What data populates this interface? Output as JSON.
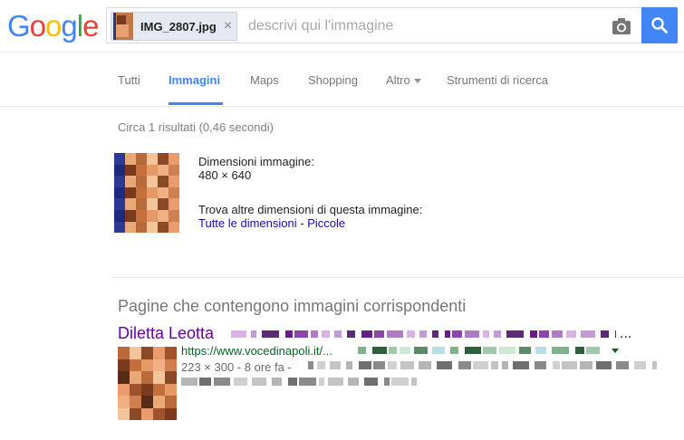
{
  "logo": {
    "text": "Google",
    "letters": [
      "G",
      "o",
      "o",
      "g",
      "l",
      "e"
    ],
    "colors": [
      "#4285f4",
      "#ea4335",
      "#fbbc05",
      "#4285f4",
      "#34a853",
      "#ea4335"
    ]
  },
  "search": {
    "chip_label": "IMG_2807.jpg",
    "chip_close": "×",
    "placeholder": "descrivi qui l'immagine",
    "camera_icon": "camera-icon",
    "search_icon": "search-icon"
  },
  "tabs": {
    "all": "Tutti",
    "images": "Immagini",
    "maps": "Maps",
    "shopping": "Shopping",
    "more": "Altro",
    "tools": "Strumenti di ricerca"
  },
  "results": {
    "stats": "Circa 1 risultati (0,46 secondi)",
    "dimensions_label": "Dimensioni immagine:",
    "dimensions_value": "480 × 640",
    "other_sizes_label": "Trova altre dimensioni di questa immagine:",
    "all_sizes_link": "Tutte le dimensioni",
    "separator": " - ",
    "small_link": "Piccole"
  },
  "matching": {
    "section_title": "Pagine che contengono immagini corrispondenti",
    "title_prefix": "Diletta Leotta",
    "title_ellipsis": "...",
    "url": "https://www.vocedinapoli.it/...",
    "meta": "223 × 300 - 8 ore fa -"
  },
  "colors": {
    "accent": "#4285f4",
    "link": "#1a0dab",
    "visited": "#660099",
    "url_green": "#006621"
  }
}
